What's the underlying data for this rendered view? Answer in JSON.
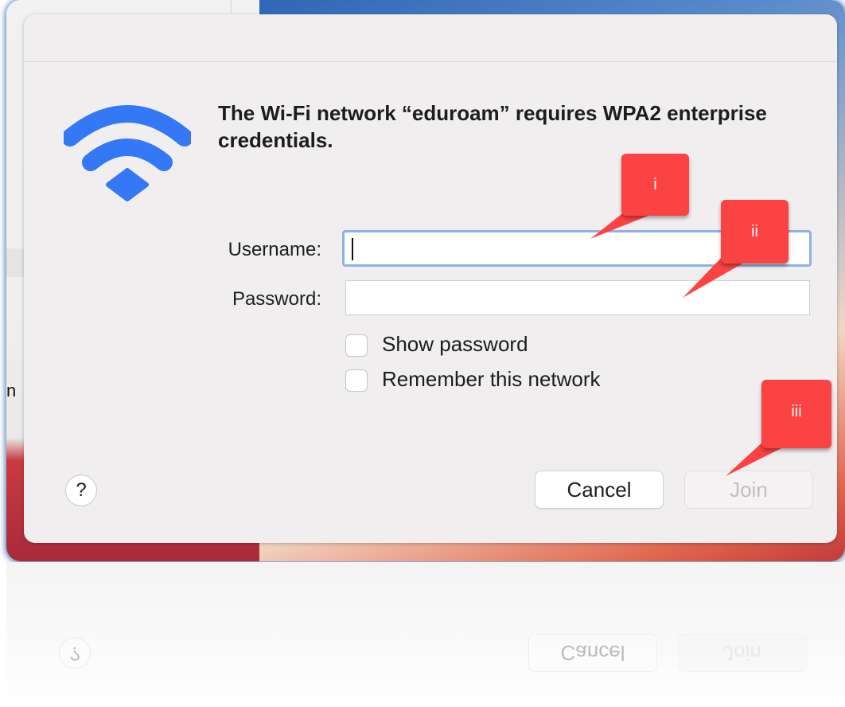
{
  "background": {
    "side_text": "n"
  },
  "dialog": {
    "heading": "The Wi-Fi network “eduroam” requires WPA2 enterprise credentials.",
    "icon": "wifi-icon",
    "username": {
      "label": "Username:",
      "value": ""
    },
    "password": {
      "label": "Password:",
      "value": ""
    },
    "checkboxes": [
      {
        "label": "Show password",
        "checked": false
      },
      {
        "label": "Remember this network",
        "checked": false
      }
    ],
    "help_label": "?",
    "cancel_label": "Cancel",
    "join_label": "Join"
  },
  "callouts": [
    {
      "label": "i"
    },
    {
      "label": "ii"
    },
    {
      "label": "iii"
    }
  ],
  "colors": {
    "accent": "#3478f6",
    "callout": "#fb4343",
    "focus_ring": "#8fb0e8"
  }
}
